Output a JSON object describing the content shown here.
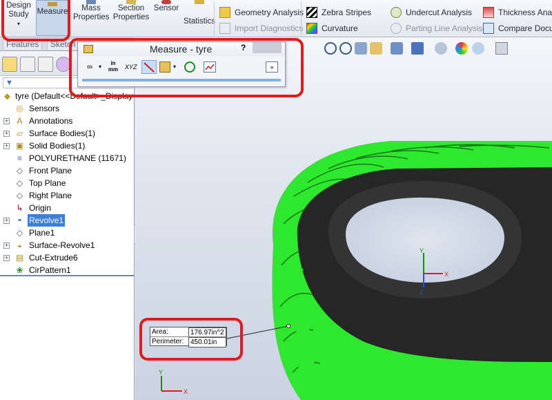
{
  "ribbon": {
    "buttons": [
      {
        "name": "design-study-button",
        "label_line1": "Design",
        "label_line2": "Study"
      },
      {
        "name": "measure-button",
        "label": "Measure"
      },
      {
        "name": "mass-properties-button",
        "label_line1": "Mass",
        "label_line2": "Properties"
      },
      {
        "name": "section-properties-button",
        "label_line1": "Section",
        "label_line2": "Properties"
      },
      {
        "name": "sensor-button",
        "label": "Sensor"
      },
      {
        "name": "statistics-button",
        "label": "Statistics"
      }
    ],
    "small_items": {
      "geometry_analysis": "Geometry Analysis",
      "import_diagnostics": "Import Diagnostics",
      "zebra_stripes": "Zebra Stripes",
      "curvature": "Curvature",
      "undercut_analysis": "Undercut Analysis",
      "parting_line_analysis": "Parting Line Analysis",
      "thickness_analysis": "Thickness Analysis",
      "compare_documents": "Compare Documents"
    }
  },
  "feature_tabs": [
    "Features",
    "Sketch"
  ],
  "measure_dialog": {
    "title": "Measure - tyre",
    "help": "?",
    "units_top": "in",
    "units_bottom": "mm",
    "xyz": "XYZ"
  },
  "tree": {
    "root": "tyre  (Default<<Default>_Display",
    "items": [
      {
        "label": "Sensors",
        "icon": "sensors-folder-icon",
        "expand": false
      },
      {
        "label": "Annotations",
        "icon": "annotations-icon",
        "expand": true
      },
      {
        "label": "Surface Bodies(1)",
        "icon": "surface-bodies-icon",
        "expand": true
      },
      {
        "label": "Solid Bodies(1)",
        "icon": "solid-bodies-icon",
        "expand": true
      },
      {
        "label": "POLYURETHANE (11671)",
        "icon": "material-icon",
        "expand": false
      },
      {
        "label": "Front Plane",
        "icon": "plane-icon",
        "expand": false
      },
      {
        "label": "Top Plane",
        "icon": "plane-icon",
        "expand": false
      },
      {
        "label": "Right Plane",
        "icon": "plane-icon",
        "expand": false
      },
      {
        "label": "Origin",
        "icon": "origin-icon",
        "expand": false
      },
      {
        "label": "Revolve1",
        "icon": "revolve-icon",
        "expand": true,
        "selected": true
      },
      {
        "label": "Plane1",
        "icon": "plane-icon",
        "expand": false
      },
      {
        "label": "Surface-Revolve1",
        "icon": "surface-revolve-icon",
        "expand": true
      },
      {
        "label": "Cut-Extrude6",
        "icon": "cut-extrude-icon",
        "expand": true
      },
      {
        "label": "CirPattern1",
        "icon": "circular-pattern-icon",
        "expand": false
      }
    ]
  },
  "measurement": {
    "area_label": "Area:",
    "area_value": "176.97in^2",
    "perimeter_label": "Perimeter:",
    "perimeter_value": "450.01in"
  },
  "triad": {
    "x": "X",
    "y": "Y",
    "z": "Z"
  },
  "colors": {
    "tyre_green": "#2ee82e",
    "tyre_dark": "#1f1f1f",
    "annotation_red": "#e31a1a",
    "selection_blue": "#3a7fd8"
  }
}
